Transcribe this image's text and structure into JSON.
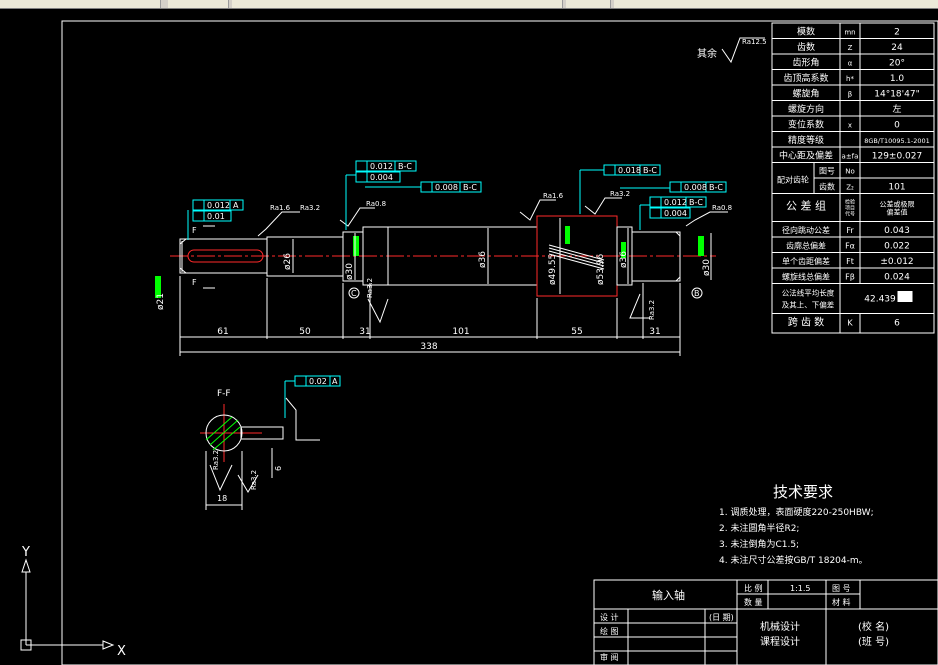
{
  "params": [
    {
      "name": "模数",
      "sym": "mn",
      "val": "2"
    },
    {
      "name": "齿数",
      "sym": "Z",
      "val": "24"
    },
    {
      "name": "齿形角",
      "sym": "α",
      "val": "20°"
    },
    {
      "name": "齿顶高系数",
      "sym": "h*",
      "val": "1.0"
    },
    {
      "name": "螺旋角",
      "sym": "β",
      "val": "14°18'47\""
    },
    {
      "name": "螺旋方向",
      "sym": "",
      "val": "左"
    },
    {
      "name": "变位系数",
      "sym": "x",
      "val": "0"
    },
    {
      "name": "精度等级",
      "sym": "",
      "val": "8GB/T10095.1-2001"
    },
    {
      "name": "中心距及偏差",
      "sym": "a±fa",
      "val": "129±0.027"
    }
  ],
  "mate": {
    "label": "配对齿轮",
    "r1_label": "图号",
    "r1_sym": "No",
    "r1_val": "",
    "r2_label": "齿数",
    "r2_sym": "Z₂",
    "r2_val": "101"
  },
  "tol_group": {
    "label": "公 差 组",
    "col_sym": "检验项目代号",
    "col_val": "公差或极限偏差值"
  },
  "tolerances": [
    {
      "name": "径向跳动公差",
      "sym": "Fr",
      "val": "0.043"
    },
    {
      "name": "齿廓总偏差",
      "sym": "Fα",
      "val": "0.022"
    },
    {
      "name": "单个齿距偏差",
      "sym": "Ft",
      "val": "±0.012"
    },
    {
      "name": "螺旋线总偏差",
      "sym": "Fβ",
      "val": "0.024"
    }
  ],
  "normal": {
    "label1": "公法线平均长度",
    "label2": "及其上、下偏差",
    "val": "42.439"
  },
  "span": {
    "label": "跨 齿 数",
    "sym": "K",
    "val": "6"
  },
  "tech": {
    "title": "技术要求",
    "items": [
      "1. 调质处理，表面硬度220-250HBW;",
      "2. 未注圆角半径R2;",
      "3. 未注倒角为C1.5;",
      "4. 未注尺寸公差按GB/T 18204-m。"
    ]
  },
  "title_block": {
    "part": "输入轴",
    "ratio_label": "比 例",
    "ratio": "1:1.5",
    "drawing_no_label": "图 号",
    "qty_label": "数 量",
    "material_label": "材 料",
    "design": "设 计",
    "draw": "绘 图",
    "review": "审 阅",
    "date": "(日 期)",
    "course1": "机械设计",
    "course2": "课程设计",
    "school": "(校  名)",
    "class": "(班  号)"
  },
  "dims": [
    "61",
    "50",
    "31",
    "101",
    "55",
    "31",
    "338"
  ],
  "dia": [
    "ø26",
    "ø30",
    "ø36",
    "ø49.55",
    "ø53.96",
    "ø36",
    "ø30",
    "ø21"
  ],
  "gdt": [
    "0.012",
    "A",
    "0.01",
    "0.012",
    "B-C",
    "0.004",
    "0.008",
    "B-C",
    "0.018",
    "B-C",
    "0.008",
    "B-C",
    "0.012",
    "B-C",
    "0.004",
    "0.02",
    "A"
  ],
  "rough": [
    "Ra1.6",
    "Ra3.2",
    "Ra0.8",
    "Ra1.6",
    "Ra3.2",
    "Ra0.8",
    "Ra3.2",
    "Ra3.2",
    "Ra3.2",
    "Ra3.2",
    "Ra12.5"
  ],
  "rest_label": "其余",
  "section": {
    "label": "F-F",
    "w": "18",
    "h": "6"
  },
  "datum": [
    "C",
    "B",
    "F",
    "F"
  ],
  "axis": {
    "y": "Y",
    "x": "X"
  },
  "colors": {
    "line": "#ffffff",
    "dim": "#ffffff",
    "gdt": "#00ffff",
    "center": "#ff2a2a",
    "green": "#00ff00"
  }
}
